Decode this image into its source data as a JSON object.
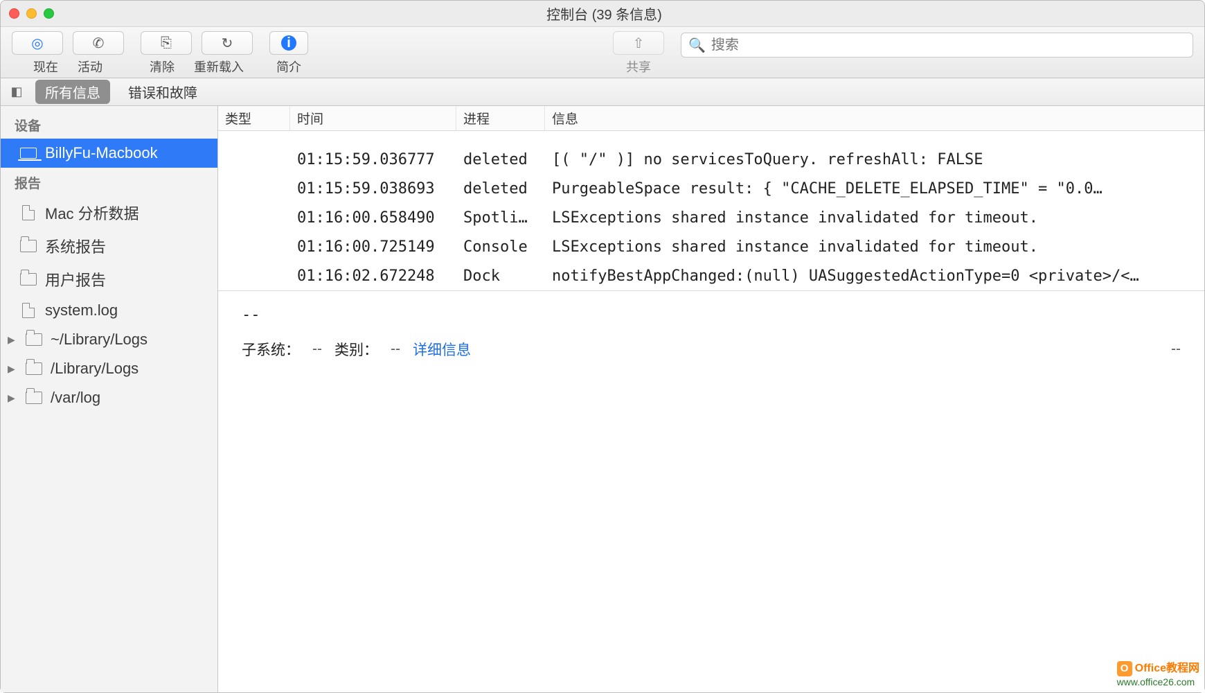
{
  "window": {
    "title": "控制台 (39 条信息)"
  },
  "toolbar": {
    "now_label": "现在",
    "activity_label": "活动",
    "clear_label": "清除",
    "reload_label": "重新载入",
    "info_label": "简介",
    "share_label": "共享"
  },
  "search": {
    "placeholder": "搜索"
  },
  "filter": {
    "all_messages": "所有信息",
    "errors_faults": "错误和故障"
  },
  "sidebar": {
    "devices_header": "设备",
    "device_name": "BillyFu-Macbook",
    "reports_header": "报告",
    "items": [
      {
        "label": "Mac 分析数据",
        "icon": "doc",
        "expandable": false
      },
      {
        "label": "系统报告",
        "icon": "folder",
        "expandable": false
      },
      {
        "label": "用户报告",
        "icon": "folder",
        "expandable": false
      },
      {
        "label": "system.log",
        "icon": "doc",
        "expandable": false
      },
      {
        "label": "~/Library/Logs",
        "icon": "folder",
        "expandable": true
      },
      {
        "label": "/Library/Logs",
        "icon": "folder",
        "expandable": true
      },
      {
        "label": "/var/log",
        "icon": "folder",
        "expandable": true
      }
    ]
  },
  "columns": {
    "type": "类型",
    "time": "时间",
    "process": "进程",
    "message": "信息"
  },
  "rows": [
    {
      "type": "",
      "time": "01:15:59.036777",
      "process": "deleted",
      "message": "[(    \"/\" )] no servicesToQuery. refreshAll: FALSE"
    },
    {
      "type": "",
      "time": "01:15:59.038693",
      "process": "deleted",
      "message": "PurgeableSpace result: {    \"CACHE_DELETE_ELAPSED_TIME\" = \"0.0…"
    },
    {
      "type": "",
      "time": "01:16:00.658490",
      "process": "Spotli…",
      "message": "LSExceptions shared instance invalidated for timeout."
    },
    {
      "type": "",
      "time": "01:16:00.725149",
      "process": "Console",
      "message": "LSExceptions shared instance invalidated for timeout."
    },
    {
      "type": "",
      "time": "01:16:02.672248",
      "process": "Dock",
      "message": "notifyBestAppChanged:(null) UASuggestedActionType=0 <private>/<…"
    }
  ],
  "detail": {
    "body": "--",
    "subsystem_label": "子系统：",
    "subsystem_value": "--",
    "category_label": "类别：",
    "category_value": "--",
    "details_link": "详细信息",
    "right_value": "--"
  },
  "watermark": {
    "line1": "Office教程网",
    "line2": "www.office26.com"
  },
  "colors": {
    "selection": "#2f7af6",
    "link": "#1f6fe5"
  }
}
